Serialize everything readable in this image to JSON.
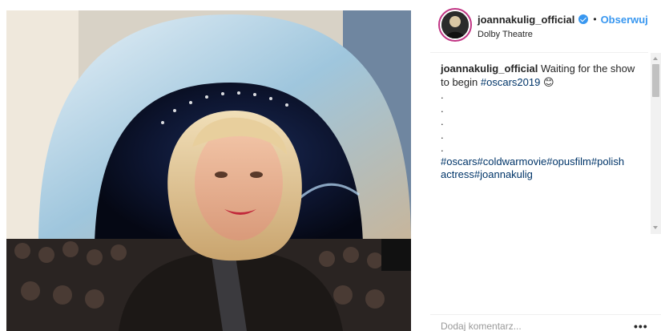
{
  "post": {
    "photo_alt": "Selfie photo",
    "username": "joannakulig_official",
    "follow_label": "Obserwuj",
    "location": "Dolby Theatre",
    "separator": "•"
  },
  "caption": {
    "username": "joannakulig_official",
    "text": " Waiting for the show to begin ",
    "hashtag_main": "#oscars2019",
    "emoji": "😊",
    "dots": ".\n.\n.\n.\n.",
    "hashtags": "#oscars#coldwarmovie#opusfilm#polish actress#joannakulig"
  },
  "comment": {
    "placeholder": "Dodaj komentarz...",
    "more_label": "•••"
  },
  "colors": {
    "link_blue": "#3897f0",
    "hashtag": "#003569",
    "story_ring": "#c13584"
  },
  "icons": {
    "verified": "verified-badge-icon",
    "more": "more-options-icon"
  }
}
